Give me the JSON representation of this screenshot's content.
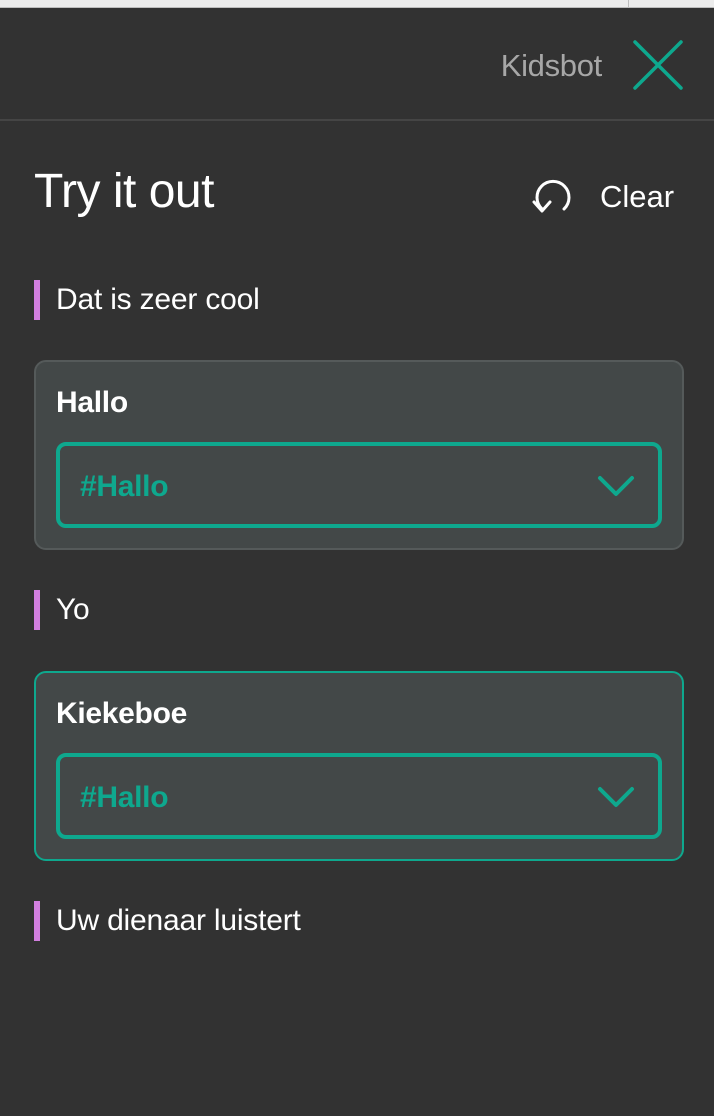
{
  "header": {
    "workspace_name": "Kidsbot",
    "close_icon": "close-icon"
  },
  "panel": {
    "title": "Try it out",
    "clear_label": "Clear",
    "clear_icon": "undo-icon"
  },
  "colors": {
    "background": "#323232",
    "accent": "#0ea88e",
    "user_marker": "#d27fdf",
    "card_background": "#434848"
  },
  "conversation": [
    {
      "type": "user",
      "text": "Dat is zeer cool"
    },
    {
      "type": "bot",
      "title": "Hallo",
      "intent": "#Hallo",
      "active": false
    },
    {
      "type": "user",
      "text": "Yo"
    },
    {
      "type": "bot",
      "title": "Kiekeboe",
      "intent": "#Hallo",
      "active": true
    },
    {
      "type": "user",
      "text": "Uw dienaar luistert"
    }
  ]
}
